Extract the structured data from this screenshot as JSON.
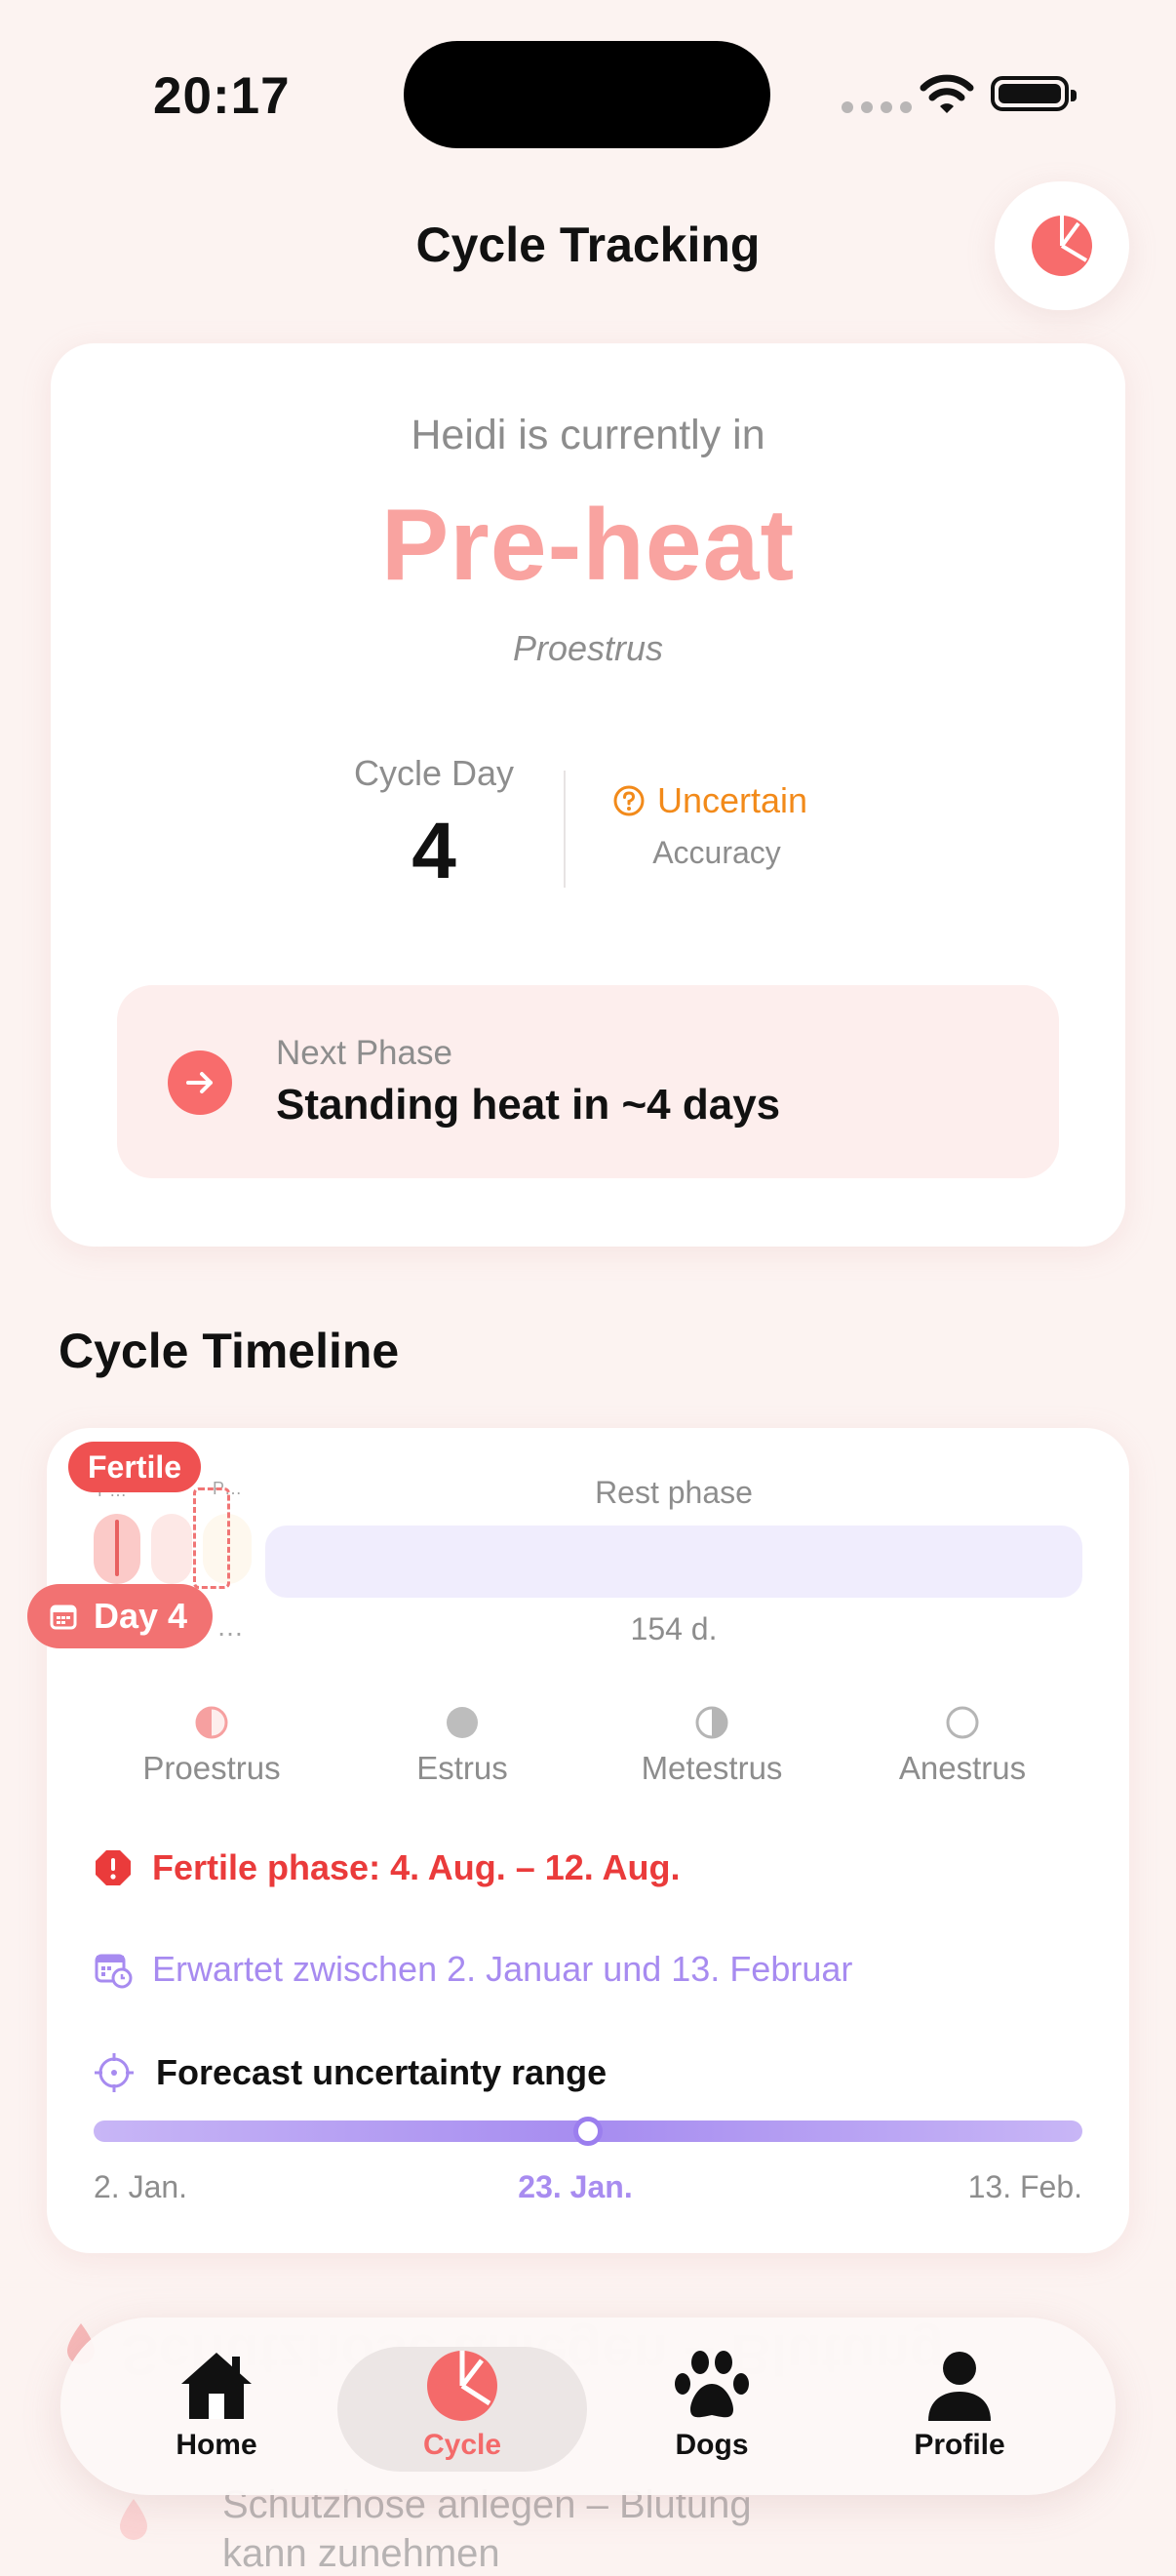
{
  "status_bar": {
    "time": "20:17"
  },
  "header": {
    "title": "Cycle Tracking",
    "action_icon": "pie-chart-icon"
  },
  "status_card": {
    "intro": "Heidi is currently in",
    "phase": "Pre-heat",
    "phase_latin": "Proestrus",
    "cycle_day_label": "Cycle Day",
    "cycle_day_value": "4",
    "accuracy_value": "Uncertain",
    "accuracy_label": "Accuracy",
    "next_phase_label": "Next Phase",
    "next_phase_value": "Standing heat in ~4 days",
    "colors": {
      "phase": "#f9a3a0",
      "accuracy": "#f28a1a",
      "next_icon": "#f86c6c"
    }
  },
  "timeline": {
    "title": "Cycle Timeline",
    "fertile_badge": "Fertile",
    "day_badge": "Day 4",
    "mini_label_p": "P…",
    "mini_ellipsis": "…",
    "rest_label": "Rest phase",
    "rest_duration": "154 d.",
    "legend": [
      {
        "label": "Proestrus",
        "icon": "half-filled-circle-icon"
      },
      {
        "label": "Estrus",
        "icon": "filled-circle-icon"
      },
      {
        "label": "Metestrus",
        "icon": "half-circle-icon"
      },
      {
        "label": "Anestrus",
        "icon": "empty-circle-icon"
      }
    ],
    "fertile_phase": "Fertile phase: 4. Aug. – 12. Aug.",
    "expected": "Erwartet zwischen 2. Januar und 13. Februar",
    "uncertainty_title": "Forecast uncertainty range",
    "range_start": "2. Jan.",
    "range_mid": "23. Jan.",
    "range_end": "13. Feb.",
    "range_knob_position": 0.5
  },
  "below": {
    "line1": "Schutzhose anlegen – Blutung",
    "line2": "kann zunehmen"
  },
  "tabs": [
    {
      "label": "Home",
      "icon": "house-icon",
      "active": false
    },
    {
      "label": "Cycle",
      "icon": "pie-chart-icon",
      "active": true
    },
    {
      "label": "Dogs",
      "icon": "paw-icon",
      "active": false
    },
    {
      "label": "Profile",
      "icon": "person-icon",
      "active": false
    }
  ]
}
